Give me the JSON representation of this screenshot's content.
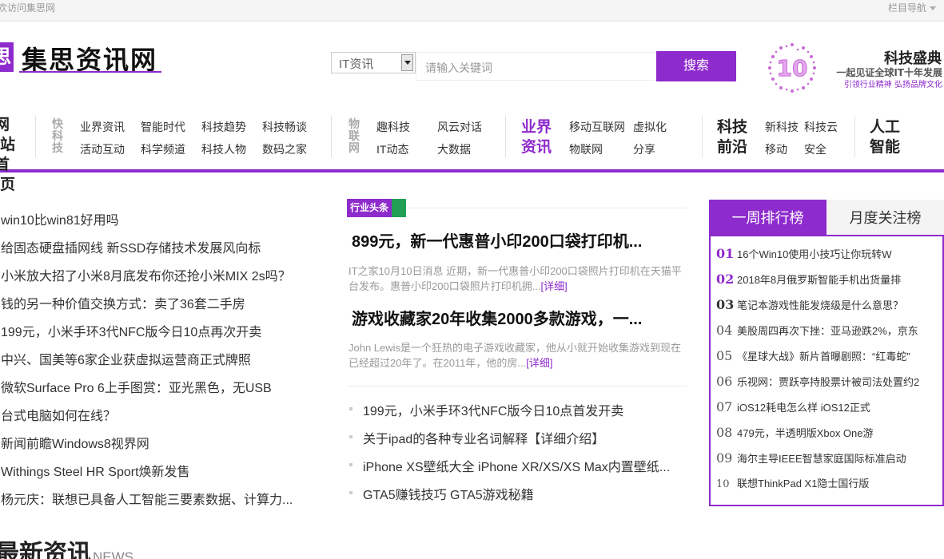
{
  "topbar": {
    "left": "欢访问集思网",
    "right": "栏目导航"
  },
  "logo": {
    "mark": "思",
    "name": "集思资讯网"
  },
  "search": {
    "category": "IT资讯",
    "placeholder": "请输入关键词",
    "button": "搜索"
  },
  "promo": {
    "badge": "10",
    "title": "科技盛典",
    "subtitle": "一起见证全球IT十年发展",
    "tagline": "引领行业精神 弘扬品牌文化"
  },
  "nav": {
    "home": [
      "网站",
      "首页"
    ],
    "groups": [
      {
        "title": "快科技",
        "links": [
          "业界资讯",
          "智能时代",
          "科技趋势",
          "科技畅谈",
          "活动互动",
          "科学频道",
          "科技人物",
          "数码之家"
        ]
      },
      {
        "title": "物联网",
        "links": [
          "趣科技",
          "风云对话",
          "IT动态",
          "大数据"
        ]
      },
      {
        "title": "业界资讯",
        "links": [
          "移动互联网",
          "虚拟化",
          "物联网",
          "分享"
        ]
      },
      {
        "title": "科技前沿",
        "links": [
          "新科技",
          "科技云",
          "移动",
          "安全"
        ]
      },
      {
        "title": "人工智能",
        "links": []
      }
    ]
  },
  "left_list": [
    "win10比win81好用吗",
    "给固态硬盘插网线 新SSD存储技术发展风向标",
    "小米放大招了小米8月底发布你还抢小米MIX 2s吗？",
    "钱的另一种价值交换方式：卖了36套二手房",
    "199元，小米手环3代NFC版今日10点再次开卖",
    "中兴、国美等6家企业获虚拟运营商正式牌照",
    "微软Surface Pro 6上手图赏：亚光黑色，无USB",
    "台式电脑如何在线？",
    "新闻前瞻Windows8视界网",
    "Withings Steel HR Sport焕新发售",
    "杨元庆：联想已具备人工智能三要素数据、计算力..."
  ],
  "section_heading": {
    "zh": "最新资讯",
    "en": "NEWS"
  },
  "headlines": {
    "tag": "行业头条",
    "items": [
      {
        "title": "899元，新一代惠普小印200口袋打印机...",
        "summary": "IT之家10月10日消息 近期，新一代惠普小印200口袋照片打印机在天猫平台发布。惠普小印200口袋照片打印机拥...",
        "more": "[详细]"
      },
      {
        "title": "游戏收藏家20年收集2000多款游戏，一...",
        "summary": "John Lewis是一个狂热的电子游戏收藏家，他从小就开始收集游戏到现在已经超过20年了。在2011年，他的房...",
        "more": "[详细]"
      }
    ],
    "list": [
      "199元，小米手环3代NFC版今日10点首发开卖",
      "关于ipad的各种专业名词解释【详细介绍】",
      "iPhone XS壁纸大全 iPhone XR/XS/XS Max内置壁纸...",
      "GTA5赚钱技巧 GTA5游戏秘籍"
    ]
  },
  "ranking": {
    "tabs": [
      "一周排行榜",
      "月度关注榜"
    ],
    "items": [
      {
        "num": "01",
        "text": "16个Win10使用小技巧让你玩转W"
      },
      {
        "num": "02",
        "text": "2018年8月俄罗斯智能手机出货量排"
      },
      {
        "num": "03",
        "text": "笔记本游戏性能发烧级是什么意思？"
      },
      {
        "num": "04",
        "text": "美股周四再次下挫：亚马逊跌2%，京东"
      },
      {
        "num": "05",
        "text": "《星球大战》新片首曝剧照：“红毒蛇”"
      },
      {
        "num": "06",
        "text": "乐视网：贾跃亭持股票计被司法处置约2"
      },
      {
        "num": "07",
        "text": "iOS12耗电怎么样 iOS12正式"
      },
      {
        "num": "08",
        "text": "479元，半透明版Xbox One游"
      },
      {
        "num": "09",
        "text": "海尔主导IEEE智慧家庭国际标准启动"
      },
      {
        "num": "10",
        "text": "联想ThinkPad X1隐士国行版"
      }
    ]
  },
  "colors": {
    "accent": "#8e2bcc",
    "tag_green": "#21a055"
  }
}
